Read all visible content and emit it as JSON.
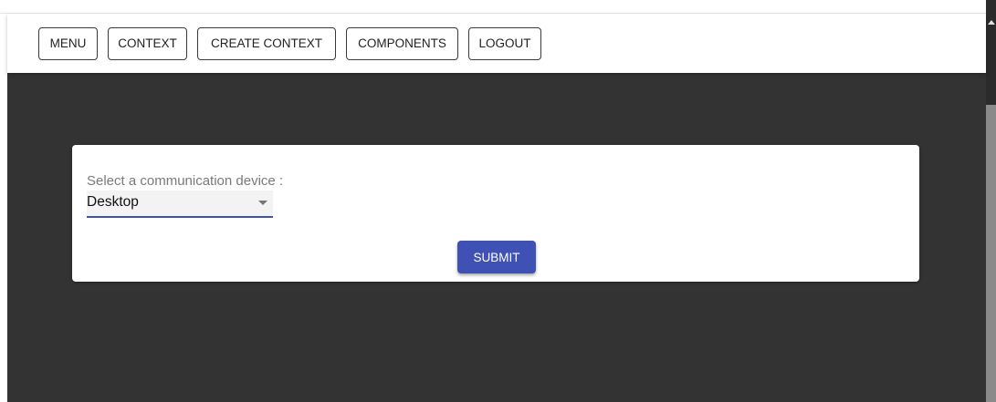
{
  "navbar": {
    "buttons": [
      {
        "label": "MENU"
      },
      {
        "label": "CONTEXT"
      },
      {
        "label": "CREATE CONTEXT"
      },
      {
        "label": "COMPONENTS"
      },
      {
        "label": "LOGOUT"
      }
    ]
  },
  "form": {
    "select_label": "Select a communication device :",
    "selected_value": "Desktop",
    "submit_label": "SUBMIT"
  },
  "colors": {
    "primary": "#3f51b5",
    "background_dark": "#333333",
    "card": "#ffffff"
  }
}
